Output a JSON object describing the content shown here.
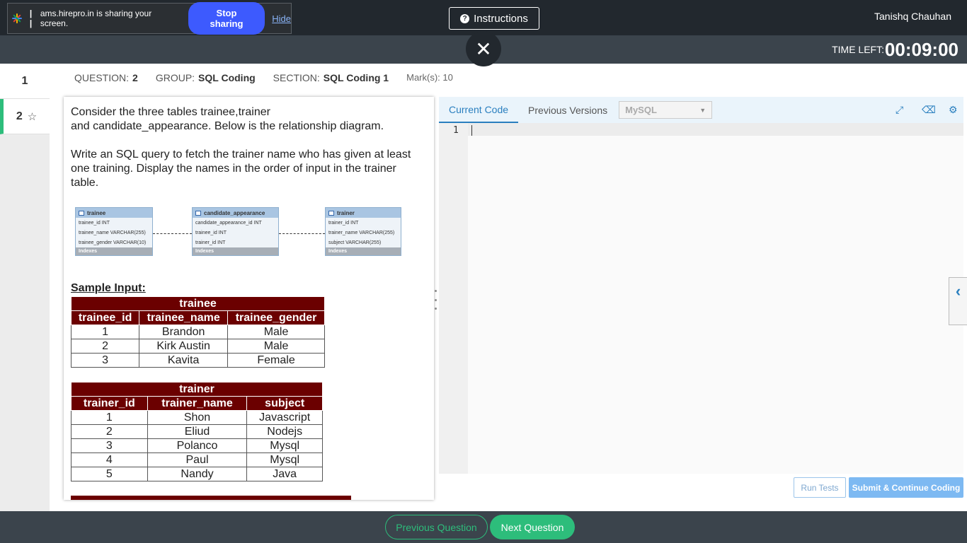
{
  "share_bar": {
    "text": "ams.hirepro.in is sharing your screen.",
    "stop_label": "Stop sharing",
    "hide_label": "Hide"
  },
  "header": {
    "instructions_label": "Instructions",
    "username": "Tanishq Chauhan",
    "time_left_label": "TIME LEFT:",
    "time_left_value": "00:09:00"
  },
  "question_nav": {
    "items": [
      {
        "label": "1"
      },
      {
        "label": "2"
      }
    ]
  },
  "question_info": {
    "question_label": "QUESTION:",
    "question_value": "2",
    "group_label": "GROUP:",
    "group_value": "SQL Coding",
    "section_label": "SECTION:",
    "section_value": "SQL Coding 1",
    "marks_label": "Mark(s):",
    "marks_value": "10"
  },
  "question": {
    "line1": "Consider the three tables trainee,trainer",
    "line2": "and candidate_appearance.  Below is the relationship diagram.",
    "para2": "Write an SQL query to fetch the trainer name who has given at least one training. Display the names in the order of input in the trainer table.",
    "sample_input_label": "Sample Input:"
  },
  "er_diagram": {
    "tables": [
      {
        "name": "trainee",
        "rows": [
          "trainee_id INT",
          "trainee_name VARCHAR(255)",
          "trainee_gender VARCHAR(10)"
        ],
        "indexes": "Indexes"
      },
      {
        "name": "candidate_appearance",
        "rows": [
          "candidate_appearance_id INT",
          "trainee_id INT",
          "trainer_id INT"
        ],
        "indexes": "Indexes"
      },
      {
        "name": "trainer",
        "rows": [
          "trainer_id INT",
          "trainer_name VARCHAR(255)",
          "subject VARCHAR(255)"
        ],
        "indexes": "Indexes"
      }
    ]
  },
  "trainee_table": {
    "title": "trainee",
    "headers": [
      "trainee_id",
      "trainee_name",
      "trainee_gender"
    ],
    "rows": [
      [
        "1",
        "Brandon",
        "Male"
      ],
      [
        "2",
        "Kirk Austin",
        "Male"
      ],
      [
        "3",
        "Kavita",
        "Female"
      ]
    ]
  },
  "trainer_table": {
    "title": "trainer",
    "headers": [
      "trainer_id",
      "trainer_name",
      "subject"
    ],
    "rows": [
      [
        "1",
        "Shon",
        "Javascript"
      ],
      [
        "2",
        "Eliud",
        "Nodejs"
      ],
      [
        "3",
        "Polanco",
        "Mysql"
      ],
      [
        "4",
        "Paul",
        "Mysql"
      ],
      [
        "5",
        "Nandy",
        "Java"
      ]
    ]
  },
  "code_panel": {
    "tab_current": "Current Code",
    "tab_previous": "Previous Versions",
    "language": "MySQL",
    "line_number": "1",
    "icons": [
      "expand-icon",
      "eraser-icon",
      "gear-icon"
    ]
  },
  "actions": {
    "run_tests": "Run Tests",
    "submit": "Submit & Continue Coding",
    "previous_question": "Previous Question",
    "next_question": "Next Question"
  },
  "colors": {
    "accent_green": "#2dbd7b",
    "table_header": "#6b0000",
    "link_blue": "#2a7fbf",
    "stop_button": "#3d5afe"
  }
}
